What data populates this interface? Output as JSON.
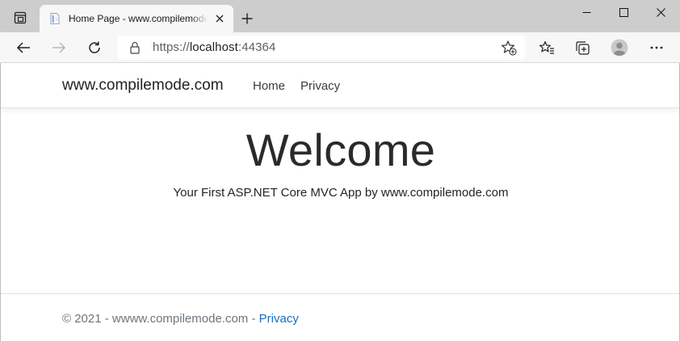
{
  "browser": {
    "tab": {
      "title": "Home Page - www.compilemode.com"
    },
    "address_bar": {
      "scheme": "https://",
      "host": "localhost",
      "port": ":44364"
    },
    "icons": [
      "tab-actions-icon",
      "page-favicon-icon",
      "close-tab-icon",
      "new-tab-icon",
      "minimize-icon",
      "maximize-icon",
      "close-window-icon",
      "back-arrow-icon",
      "forward-arrow-icon",
      "refresh-icon",
      "lock-icon",
      "add-favorite-icon",
      "favorites-icon",
      "collections-icon",
      "profile-icon",
      "more-icon"
    ]
  },
  "site": {
    "brand": "www.compilemode.com",
    "nav": [
      {
        "label": "Home"
      },
      {
        "label": "Privacy"
      }
    ],
    "main": {
      "heading": "Welcome",
      "lead": "Your First ASP.NET Core MVC App by www.compilemode.com"
    },
    "footer": {
      "text": "© 2021 - wwww.compilemode.com - ",
      "link": "Privacy"
    }
  },
  "colors": {
    "link": "#1b6ec2",
    "footer_text": "#6c757d",
    "tab_strip": "#cdcdcd",
    "toolbar": "#f7f7f7"
  }
}
